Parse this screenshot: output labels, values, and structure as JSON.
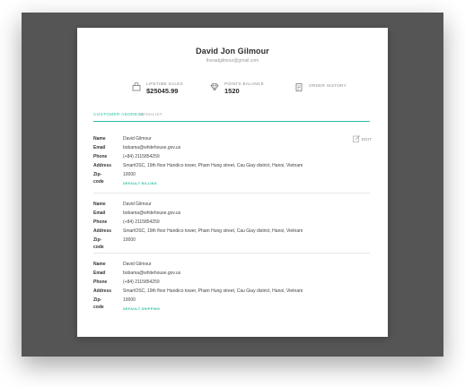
{
  "profile": {
    "name": "David Jon Gilmour",
    "email": "theradgilmour@gmail.com"
  },
  "stats": [
    {
      "icon": "bag-icon",
      "label": "LIFETIME SALES",
      "value": "$25045.99"
    },
    {
      "icon": "diamond-icon",
      "label": "POINTS BALANCE",
      "value": "1520"
    },
    {
      "icon": "clipboard-icon",
      "label": "ORDER HISTORY",
      "value": ""
    }
  ],
  "tabs": [
    {
      "label": "CUSTOMER ADDRESS",
      "active": true
    },
    {
      "label": "WISHLIST",
      "active": false
    }
  ],
  "edit_label": "EDIT",
  "field_labels": {
    "name": "Name",
    "email": "Email",
    "phone": "Phone",
    "address": "Address",
    "zip": "Zip-code"
  },
  "addresses": [
    {
      "name": "David Gilmour",
      "email": "bobama@whitehouse.gov.us",
      "phone": "(+84) 2115854259",
      "address": "SmartOSC, 19th floor Handico tower, Pham Hung street, Cau Giay district, Hanoi, Vietnam",
      "zip": "10000",
      "badge": "DEFAULT BILLING"
    },
    {
      "name": "David Gilmour",
      "email": "bobama@whitehouse.gov.us",
      "phone": "(+84) 2115854259",
      "address": "SmartOSC, 19th floor Handico tower, Pham Hung street, Cau Giay district, Hanoi, Vietnam",
      "zip": "10000",
      "badge": ""
    },
    {
      "name": "David Gilmour",
      "email": "bobama@whitehouse.gov.us",
      "phone": "(+84) 2115854259",
      "address": "SmartOSC, 19th floor Handico tower, Pham Hung street, Cau Giay district, Hanoi, Vietnam",
      "zip": "10000",
      "badge": "DEFAULT SHIPPING"
    }
  ],
  "colors": {
    "accent": "#2fbfa6",
    "backdrop": "#555555"
  }
}
